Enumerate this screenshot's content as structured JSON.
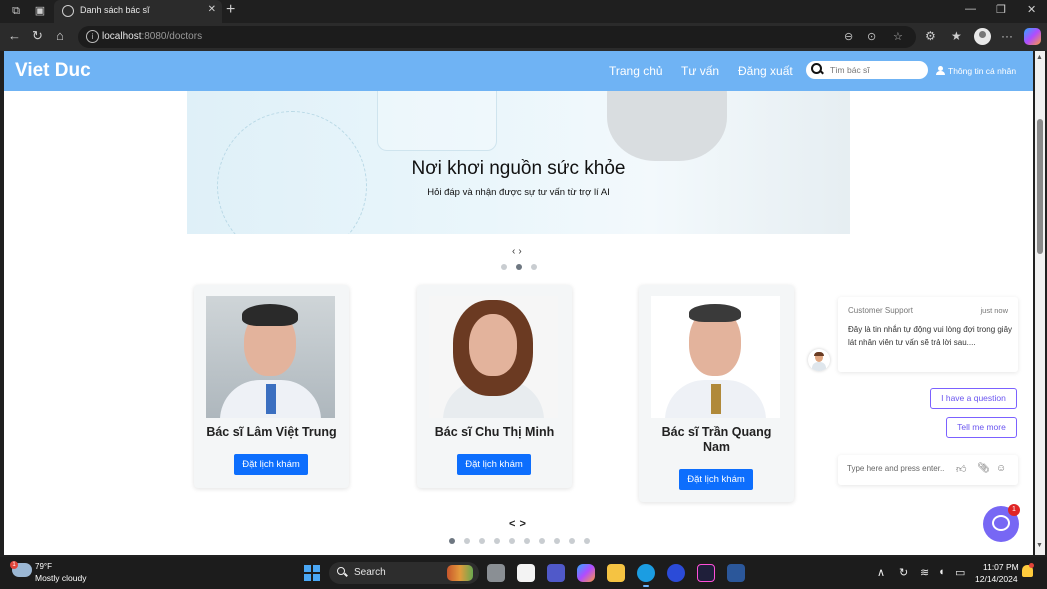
{
  "browser": {
    "tab_title": "Danh sách bác sĩ",
    "url_host": "localhost",
    "url_path": ":8080/doctors"
  },
  "site": {
    "brand": "Viet Duc",
    "nav": [
      "Trang chủ",
      "Tư vấn",
      "Đăng xuất"
    ],
    "search_placeholder": "Tìm bác sĩ",
    "user_link": "Thông tin cá nhân"
  },
  "hero": {
    "title": "Nơi khơi nguồn sức khỏe",
    "subtitle": "Hỏi đáp và nhận được sự tư vấn từ trợ lí AI",
    "prev": "‹",
    "next": "›",
    "active_slide": 2,
    "slide_count": 3
  },
  "doctors": [
    {
      "name": "Bác sĩ Lâm Việt Trung",
      "button": "Đặt lịch khám"
    },
    {
      "name": "Bác sĩ Chu Thị Minh",
      "button": "Đặt lịch khám"
    },
    {
      "name": "Bác sĩ Trần Quang Nam",
      "button": "Đặt lịch khám"
    }
  ],
  "doctor_carousel": {
    "prev": "<",
    "next": ">",
    "active_page": 1,
    "page_count": 10
  },
  "chat": {
    "sender": "Customer Support",
    "time": "just now",
    "message": "Đây là tin nhắn tự động vui lòng đợi trong giây lát nhân viên tư vấn sẽ trả lời sau....",
    "quick_replies": [
      "I have a question",
      "Tell me more"
    ],
    "input_placeholder": "Type here and press enter..",
    "unread_count": "1"
  },
  "taskbar": {
    "temperature": "79°F",
    "weather": "Mostly cloudy",
    "weather_badge": "1",
    "search_label": "Search",
    "time": "11:07 PM",
    "date": "12/14/2024"
  },
  "colors": {
    "header": "#6fb3f4",
    "primary_button": "#0d6efd",
    "chat_accent": "#7767f4"
  }
}
